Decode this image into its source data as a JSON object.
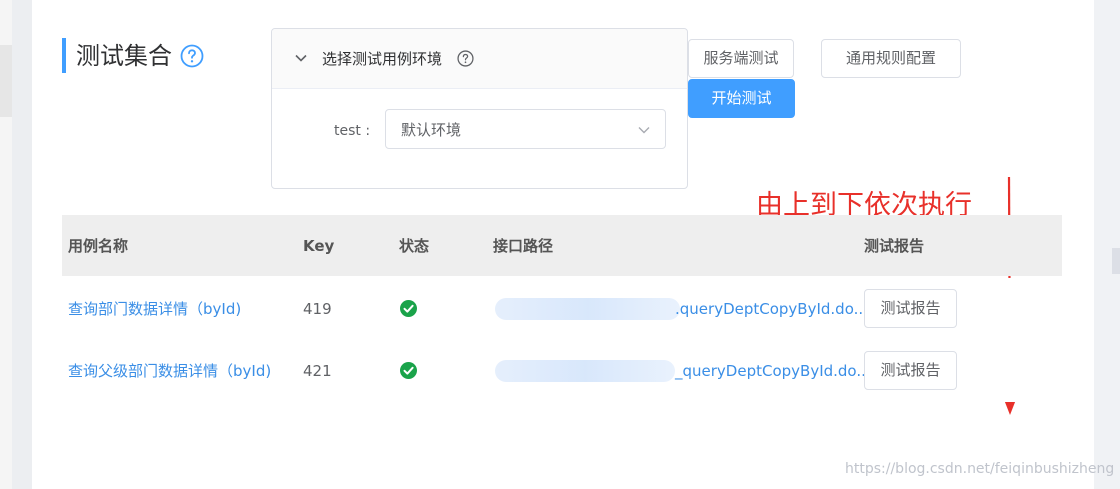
{
  "page": {
    "title": "测试集合",
    "watermark": "https://blog.csdn.net/feiqinbushizheng"
  },
  "env_panel": {
    "header_label": "选择测试用例环境",
    "field_label": "test :",
    "selected_env": "默认环境"
  },
  "buttons": {
    "server_test": "服务端测试",
    "rule_config": "通用规则配置",
    "start_test": "开始测试"
  },
  "annotation": "由上到下依次执行",
  "table": {
    "columns": [
      "用例名称",
      "Key",
      "状态",
      "接口路径",
      "测试报告"
    ],
    "rows": [
      {
        "name": "查询部门数据详情（byId)",
        "key": "419",
        "status": "success",
        "path": ".queryDeptCopyById.do...",
        "report": "测试报告"
      },
      {
        "name": "查询父级部门数据详情（byId)",
        "key": "421",
        "status": "success",
        "path": "_queryDeptCopyById.do...",
        "report": "测试报告"
      }
    ]
  },
  "colors": {
    "primary": "#409eff",
    "link": "#3a8ee6",
    "success": "#1aa34a",
    "annotation": "#e8302a"
  }
}
